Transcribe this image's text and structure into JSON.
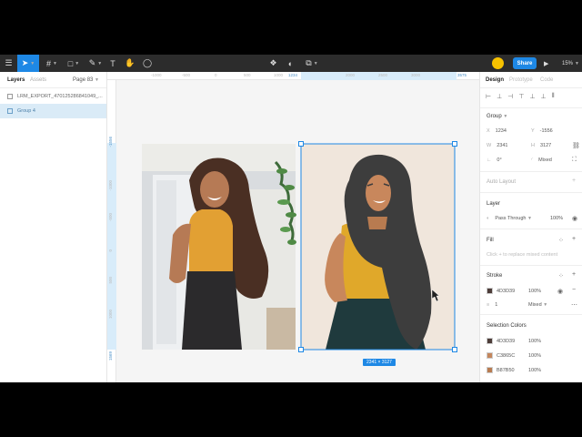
{
  "toolbar": {
    "menu_icon": "hamburger-menu-icon",
    "tools": [
      {
        "name": "move-tool",
        "glyph": "⌖"
      },
      {
        "name": "frame-tool",
        "glyph": "#"
      },
      {
        "name": "shape-tool",
        "glyph": "□"
      },
      {
        "name": "pen-tool",
        "glyph": "✎"
      },
      {
        "name": "text-tool",
        "glyph": "T"
      },
      {
        "name": "hand-tool",
        "glyph": "✋"
      },
      {
        "name": "comment-tool",
        "glyph": "◯"
      }
    ],
    "avatar_initial": "",
    "share_label": "Share",
    "zoom_label": "15%"
  },
  "left_panel": {
    "tabs": {
      "layers": "Layers",
      "assets": "Assets"
    },
    "page_label": "Page 83",
    "layers": [
      {
        "name": "LRM_EXPORT_47012528684104​9_...",
        "selected": false
      },
      {
        "name": "Group 4",
        "selected": true
      }
    ]
  },
  "rulers": {
    "top": [
      {
        "label": "-1000",
        "hl": false
      },
      {
        "label": "-500",
        "hl": false
      },
      {
        "label": "0",
        "hl": false
      },
      {
        "label": "500",
        "hl": false
      },
      {
        "label": "1000",
        "hl": false
      },
      {
        "label": "1234",
        "hl": true
      },
      {
        "label": "2000",
        "hl": false
      },
      {
        "label": "2500",
        "hl": false
      },
      {
        "label": "3000",
        "hl": false
      },
      {
        "label": "3575",
        "hl": true
      }
    ],
    "left": [
      {
        "label": "-1556",
        "hl": true
      },
      {
        "label": "-1000",
        "hl": false
      },
      {
        "label": "-500",
        "hl": false
      },
      {
        "label": "0",
        "hl": false
      },
      {
        "label": "500",
        "hl": false
      },
      {
        "label": "1000",
        "hl": false
      },
      {
        "label": "1569",
        "hl": true
      }
    ]
  },
  "canvas": {
    "size_badge": "2341 × 3127",
    "colors": {
      "background_beige": "#f0e6dc",
      "hair": "#3d3d3d",
      "skin": "#c8875c",
      "top": "#e0a82a",
      "jeans": "#1f3a3d",
      "selection": "#1e88e5"
    }
  },
  "right_panel": {
    "tabs": {
      "design": "Design",
      "prototype": "Prototype",
      "code": "Code"
    },
    "group_label": "Group",
    "x": "1234",
    "y": "-1556",
    "w": "2341",
    "h": "3127",
    "rotation": "0°",
    "radius": "Mixed",
    "auto_layout": "Auto Layout",
    "layer_title": "Layer",
    "blend_mode": "Pass Through",
    "layer_opacity": "100%",
    "fill_title": "Fill",
    "fill_hint": "Click + to replace mixed content",
    "stroke_title": "Stroke",
    "stroke_color": "4D3D39",
    "stroke_opacity": "100%",
    "stroke_weight": "1",
    "stroke_style": "Mixed",
    "selection_colors_title": "Selection Colors",
    "selection_colors": [
      {
        "hex": "4D3D39",
        "opacity": "100%",
        "swatch": "#4d3d39"
      },
      {
        "hex": "C3865C",
        "opacity": "100%",
        "swatch": "#c3865c"
      },
      {
        "hex": "B87B50",
        "opacity": "100%",
        "swatch": "#b87b50"
      }
    ]
  }
}
